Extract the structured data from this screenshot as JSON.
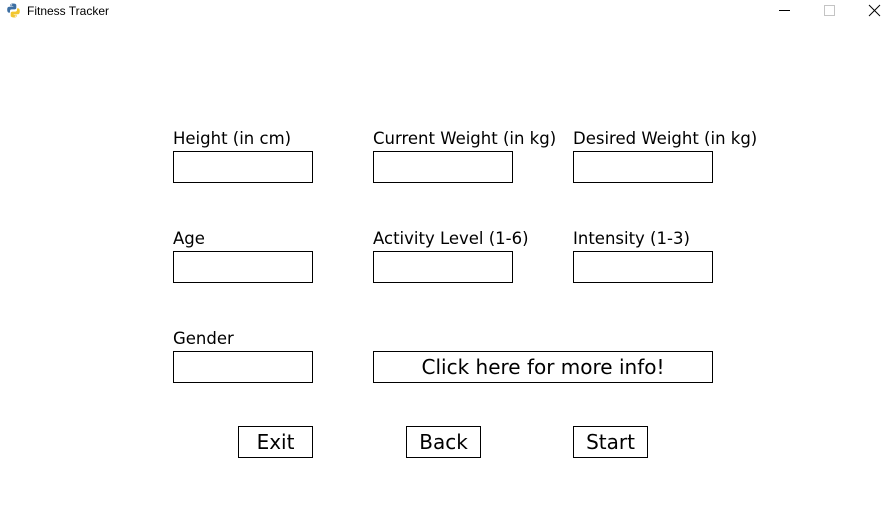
{
  "window": {
    "title": "Fitness Tracker",
    "icon": "python-snake-icon"
  },
  "form": {
    "height": {
      "label": "Height (in cm)",
      "value": ""
    },
    "current_weight": {
      "label": "Current Weight (in kg)",
      "value": ""
    },
    "desired_weight": {
      "label": "Desired Weight (in kg)",
      "value": ""
    },
    "age": {
      "label": "Age",
      "value": ""
    },
    "activity_level": {
      "label": "Activity Level (1-6)",
      "value": ""
    },
    "intensity": {
      "label": "Intensity (1-3)",
      "value": ""
    },
    "gender": {
      "label": "Gender",
      "value": ""
    }
  },
  "buttons": {
    "info": "Click here for more info!",
    "exit": "Exit",
    "back": "Back",
    "start": "Start"
  }
}
